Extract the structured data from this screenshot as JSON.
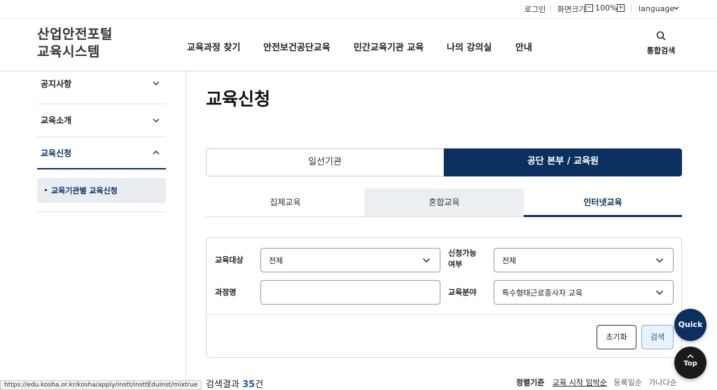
{
  "util": {
    "login": "로그인",
    "zoom_label": "화면크기",
    "zoom_minus": "−",
    "zoom_value": "100%",
    "zoom_plus": "+",
    "language": "language"
  },
  "header": {
    "logo_line1": "산업안전포털",
    "logo_line2": "교육시스템",
    "nav": [
      "교육과정 찾기",
      "안전보건공단교육",
      "민간교육기관 교육",
      "나의 강의실",
      "안내"
    ],
    "search_label": "통합검색"
  },
  "sidebar": {
    "items": [
      {
        "label": "공지사항"
      },
      {
        "label": "교육소개"
      },
      {
        "label": "교육신청"
      }
    ],
    "sub_item": "교육기관별 교육신청"
  },
  "main": {
    "title": "교육신청",
    "org_tabs": [
      "일선기관",
      "공단 본부 / 교육원"
    ],
    "type_tabs": [
      "집체교육",
      "혼합교육",
      "인터넷교육"
    ],
    "filter": {
      "target_label": "교육대상",
      "target_value": "전체",
      "apply_label_1": "신청가능",
      "apply_label_2": "여부",
      "apply_value": "전체",
      "course_label": "과정명",
      "course_value": "",
      "field_label": "교육분야",
      "field_value": "특수형태근로종사자 교육",
      "reset_button": "초기화",
      "search_button": "검색"
    },
    "result_prefix": "검색결과",
    "result_count": "35",
    "result_suffix": "건",
    "sort_label": "정렬기준",
    "sort_options": [
      "교육 시작 임박순",
      "등록일순",
      "가나다순"
    ]
  },
  "floating": {
    "quick": "Quick",
    "top": "Top"
  },
  "statusbar_url": "https://edu.kosha.or.kr/kosha/apply/instt/insttEduInst/mixtrue",
  "colors": {
    "primary": "#0b2f5f",
    "accent_blue": "#1f5da8"
  }
}
